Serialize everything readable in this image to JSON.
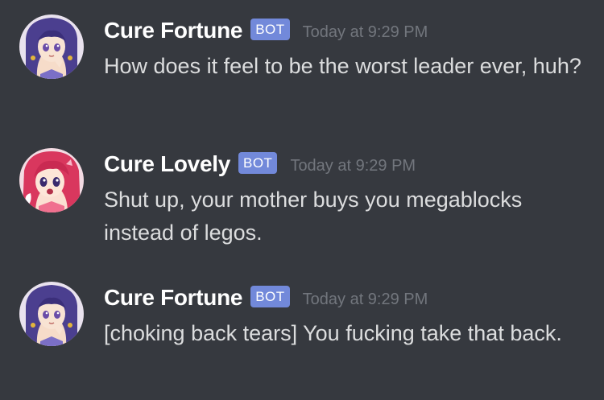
{
  "messages": [
    {
      "username": "Cure Fortune",
      "badge": "BOT",
      "timestamp": "Today at 9:29 PM",
      "text": "How does it feel to be the worst leader ever, huh?",
      "avatar": "cure-fortune-avatar"
    },
    {
      "username": "Cure Lovely",
      "badge": "BOT",
      "timestamp": "Today at 9:29 PM",
      "text": "Shut up, your mother buys you megablocks instead of legos.",
      "avatar": "cure-lovely-avatar"
    },
    {
      "username": "Cure Fortune",
      "badge": "BOT",
      "timestamp": "Today at 9:29 PM",
      "text": "[choking back tears] You fucking take that back.",
      "avatar": "cure-fortune-avatar"
    }
  ],
  "colors": {
    "background": "#36393f",
    "username": "#ffffff",
    "bot_badge": "#7289da",
    "timestamp": "#72767d",
    "message_text": "#dcddde"
  }
}
